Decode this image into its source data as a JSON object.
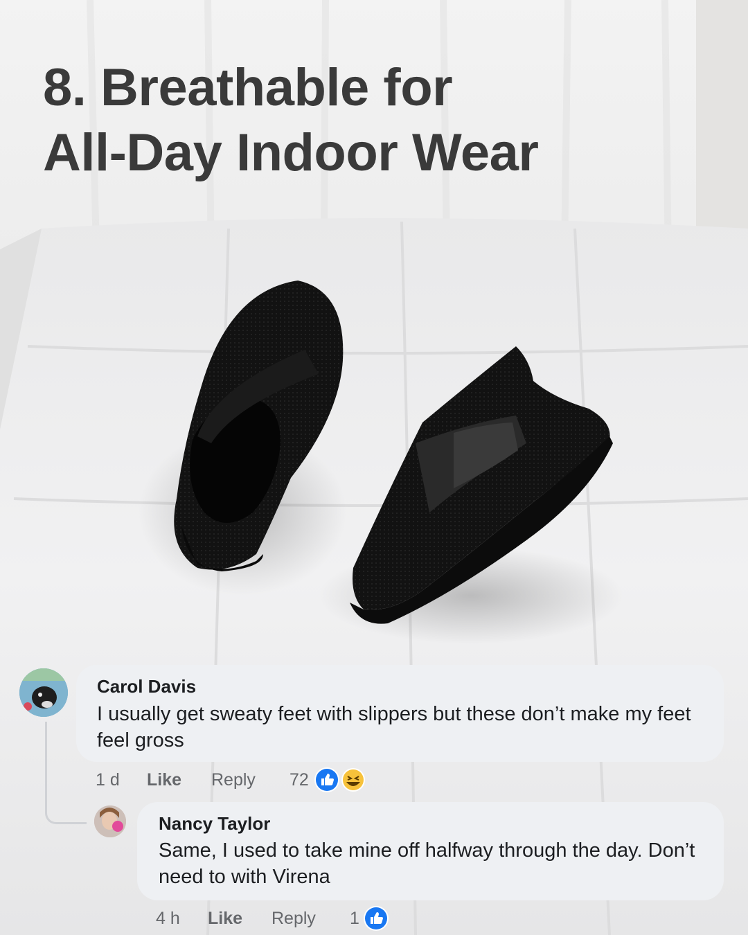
{
  "headline": {
    "line1": "8. Breathable for",
    "line2": "All-Day Indoor Wear"
  },
  "comments": [
    {
      "author": "Carol Davis",
      "text": "I usually get sweaty feet with slippers but these don’t make my feet feel gross",
      "time": "1 d",
      "like_label": "Like",
      "reply_label": "Reply",
      "reaction_count": "72",
      "reactions": [
        "like-icon",
        "laughing-emoji-icon"
      ]
    },
    {
      "author": "Nancy Taylor",
      "text": "Same, I used to take mine off halfway through the day. Don’t need to with Virena",
      "time": "4 h",
      "like_label": "Like",
      "reply_label": "Reply",
      "reaction_count": "1",
      "reactions": [
        "like-icon"
      ]
    }
  ],
  "colors": {
    "headline": "#3a3a3a",
    "bubble": "#eef0f3",
    "like_blue": "#1877f2",
    "meta": "#65676b"
  }
}
